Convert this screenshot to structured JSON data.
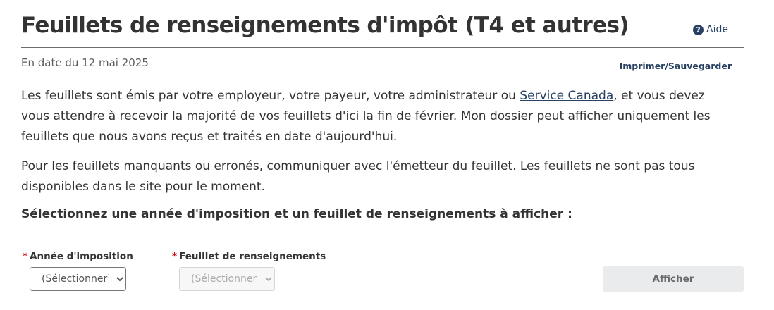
{
  "header": {
    "title": "Feuillets de renseignements d'impôt (T4 et autres)",
    "help_icon_glyph": "?",
    "help_label": "Aide",
    "as_of": "En date du 12 mai 2025",
    "print_label": "Imprimer/Sauvegarder"
  },
  "content": {
    "para1_before_link": "Les feuillets sont émis par votre employeur, votre payeur, votre administrateur ou ",
    "para1_link": "Service Canada",
    "para1_after_link": ", et vous devez vous attendre à recevoir la majorité de vos feuillets d'ici la fin de février. Mon dossier peut afficher uniquement les feuillets que nous avons reçus et traités en date d'aujourd'hui.",
    "para2": "Pour les feuillets manquants ou erronés, communiquer avec l'émetteur du feuillet. Les feuillets ne sont pas tous disponibles dans le site pour le moment.",
    "select_heading": "Sélectionnez une année d'imposition et un feuillet de renseignements à afficher :"
  },
  "form": {
    "required_marker": "*",
    "year_label": "Année d'imposition",
    "year_selected": "(Sélectionner)",
    "slip_label": "Feuillet de renseignements",
    "slip_selected": "(Sélectionner)",
    "show_button": "Afficher"
  },
  "colors": {
    "link": "#284162",
    "required": "#d3080c",
    "button_disabled_bg": "#eaebed"
  }
}
